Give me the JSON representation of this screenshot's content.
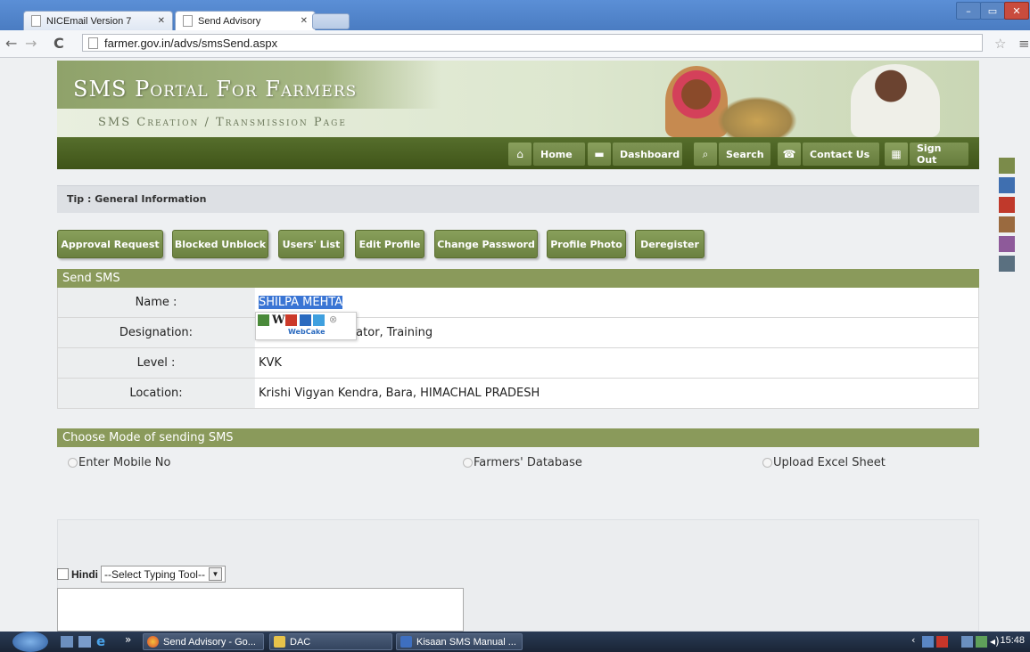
{
  "browser": {
    "tabs": [
      {
        "label": "NICEmail Version 7"
      },
      {
        "label": "Send Advisory"
      }
    ],
    "url": "farmer.gov.in/advs/smsSend.aspx"
  },
  "banner": {
    "title": "SMS Portal For Farmers",
    "subtitle": "SMS Creation / Transmission Page"
  },
  "nav": {
    "home": "Home",
    "dashboard": "Dashboard",
    "search": "Search",
    "contact": "Contact Us",
    "signout": "Sign Out"
  },
  "tip": "Tip : General Information",
  "action_buttons": [
    "Approval Request",
    "Blocked Unblock",
    "Users' List",
    "Edit Profile",
    "Change Password",
    "Profile Photo",
    "Deregister"
  ],
  "send_sms": {
    "header": "Send SMS",
    "rows": [
      {
        "label": "Name :",
        "value": "SHILPA MEHTA"
      },
      {
        "label": "Designation:",
        "value": "Program Coordinator, Training"
      },
      {
        "label": "Level :",
        "value": "KVK"
      },
      {
        "label": "Location:",
        "value": "Krishi Vigyan Kendra, Bara, HIMACHAL PRADESH"
      }
    ]
  },
  "webcake_label": "WebCake",
  "mode": {
    "header": "Choose Mode of sending SMS",
    "options": [
      "Enter Mobile No",
      "Farmers' Database",
      "Upload Excel Sheet"
    ]
  },
  "compose": {
    "hindi_label": "Hindi",
    "typing_tool": "--Select Typing Tool--"
  },
  "theme_colors": [
    "#7b8b4a",
    "#3f6fb0",
    "#c0392b",
    "#9a6a3f",
    "#8e5a9a",
    "#5a7080"
  ],
  "taskbar": {
    "items": [
      "Send Advisory - Go...",
      "DAC",
      "Kisaan SMS Manual ..."
    ],
    "clock": "15:48"
  }
}
